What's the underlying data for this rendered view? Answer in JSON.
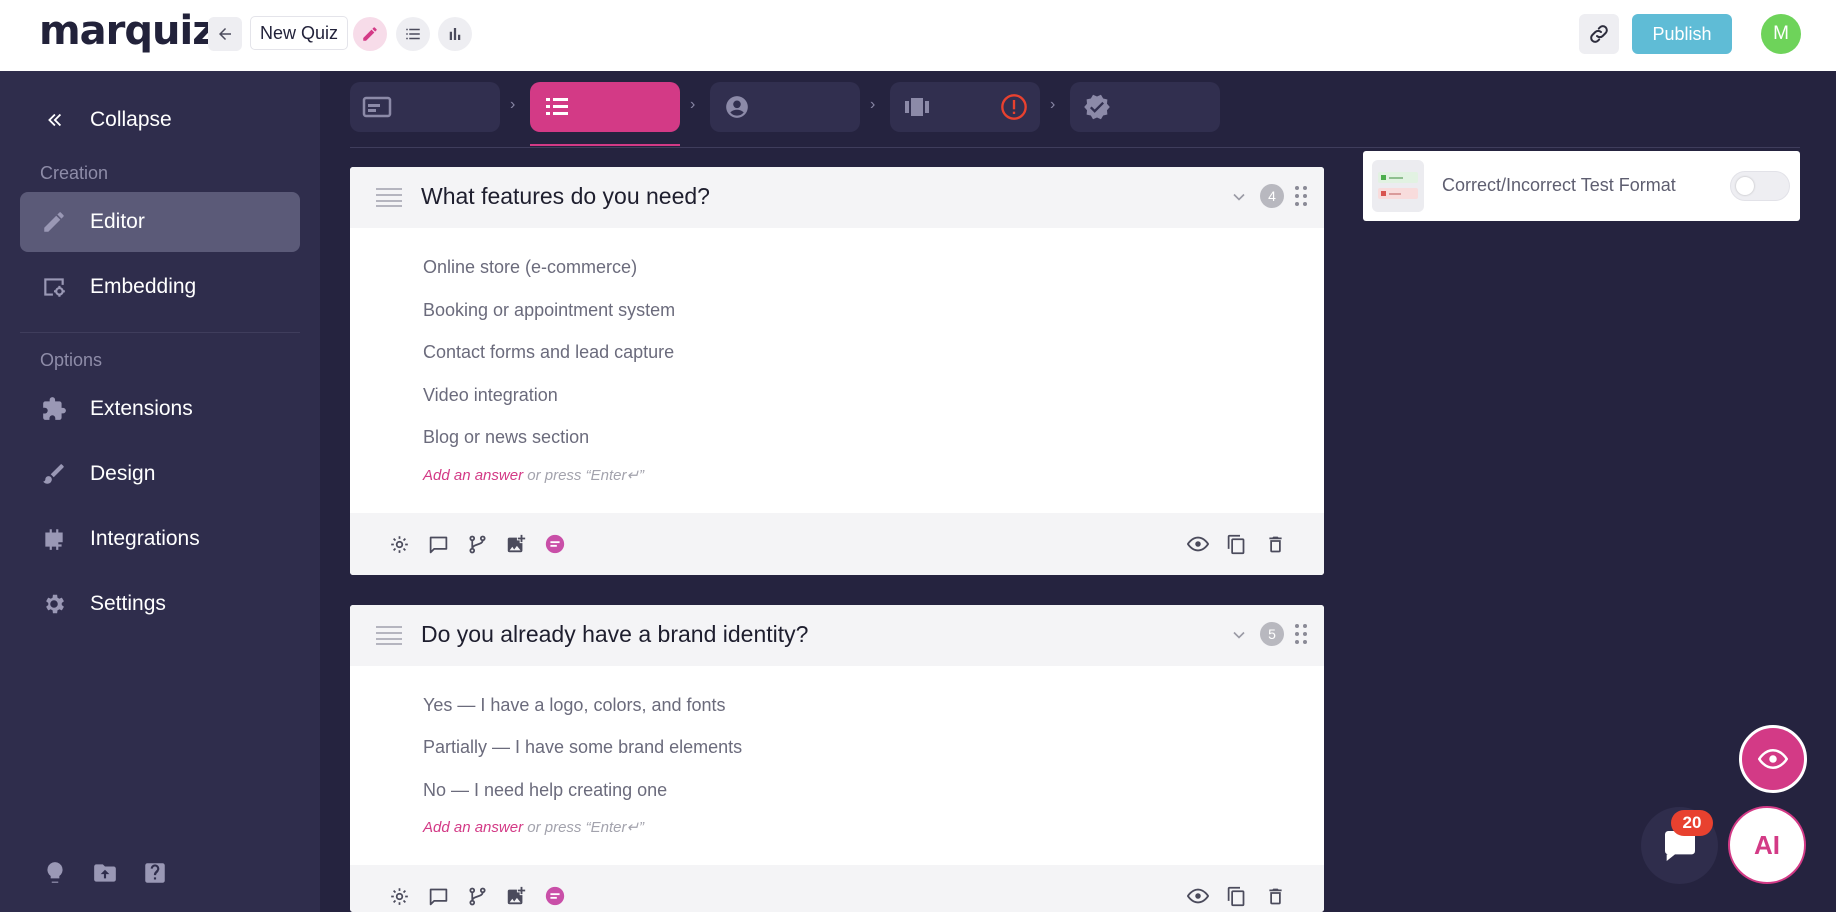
{
  "app": {
    "logo": "marquiz",
    "quiz_name": "New Quiz",
    "publish_label": "Publish",
    "avatar_initial": "M"
  },
  "colors": {
    "accent": "#d33a86",
    "publish": "#5fbcd6",
    "sidebar_bg": "#2f2d4c",
    "canvas_bg": "#25233f",
    "avatar": "#6ed35a",
    "warning": "#e8412f"
  },
  "toolbar": {
    "icons": [
      "back-arrow-icon",
      "pencil-icon",
      "list-icon",
      "bar-chart-icon",
      "link-icon"
    ]
  },
  "sidebar": {
    "collapse_label": "Collapse",
    "section_creation": "Creation",
    "section_options": "Options",
    "items": [
      {
        "label": "Editor",
        "icon": "pencil-icon",
        "active": true
      },
      {
        "label": "Embedding",
        "icon": "embed-icon",
        "active": false
      },
      {
        "label": "Extensions",
        "icon": "puzzle-icon",
        "active": false
      },
      {
        "label": "Design",
        "icon": "brush-icon",
        "active": false
      },
      {
        "label": "Integrations",
        "icon": "plug-icon",
        "active": false
      },
      {
        "label": "Settings",
        "icon": "gear-icon",
        "active": false
      }
    ],
    "bottom_icons": [
      "lightbulb-icon",
      "folder-upload-icon",
      "help-icon"
    ]
  },
  "steps": [
    {
      "name": "start-page",
      "icon": "start-page-icon",
      "active": false
    },
    {
      "name": "questions",
      "icon": "list-icon",
      "active": true
    },
    {
      "name": "contact-form",
      "icon": "user-circle-icon",
      "active": false
    },
    {
      "name": "results",
      "icon": "results-icon",
      "active": false,
      "warning": true
    },
    {
      "name": "thank-you",
      "icon": "verified-badge-icon",
      "active": false
    }
  ],
  "questions": [
    {
      "title": "What features do you need?",
      "number": "4",
      "answers": [
        "Online store (e-commerce)",
        "Booking or appointment system",
        "Contact forms and lead capture",
        "Video integration",
        "Blog or news section"
      ],
      "add_answer_link": "Add an answer",
      "add_answer_hint": "or press “Enter↵”"
    },
    {
      "title": "Do you already have a brand identity?",
      "number": "5",
      "answers": [
        "Yes — I have a logo, colors, and fonts",
        "Partially — I have some brand elements",
        "No — I need help creating one"
      ],
      "add_answer_link": "Add an answer",
      "add_answer_hint": "or press “Enter↵”"
    }
  ],
  "extension": {
    "label": "Correct/Incorrect Test Format",
    "enabled": false
  },
  "floating": {
    "ai_label": "AI",
    "chat_badge": "20"
  }
}
